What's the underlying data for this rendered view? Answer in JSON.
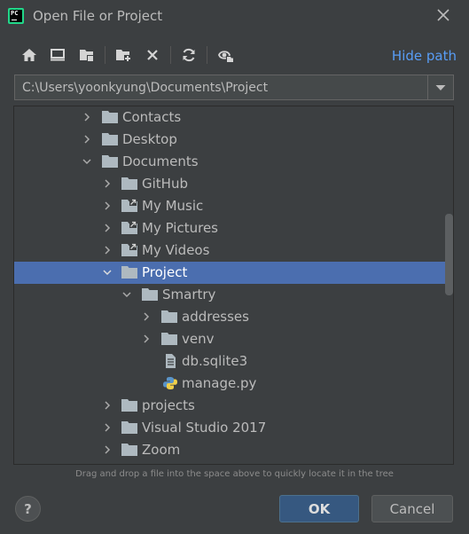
{
  "window": {
    "title": "Open File or Project",
    "logo_text": "PC"
  },
  "toolbar": {
    "hide_path_label": "Hide path",
    "buttons": [
      "home-icon",
      "desktop-icon",
      "project-folder-icon",
      "new-folder-icon",
      "delete-icon",
      "refresh-icon",
      "show-hidden-icon"
    ]
  },
  "path": {
    "value": "C:\\Users\\yoonkyung\\Documents\\Project"
  },
  "tree": {
    "rows": [
      {
        "label": "Contacts",
        "expanded": false
      },
      {
        "label": "Desktop",
        "expanded": false
      },
      {
        "label": "Documents",
        "expanded": true
      },
      {
        "label": "GitHub",
        "expanded": false
      },
      {
        "label": "My Music",
        "expanded": false,
        "symlink": true
      },
      {
        "label": "My Pictures",
        "expanded": false,
        "symlink": true
      },
      {
        "label": "My Videos",
        "expanded": false,
        "symlink": true
      },
      {
        "label": "Project",
        "expanded": true,
        "selected": true
      },
      {
        "label": "Smartry",
        "expanded": true
      },
      {
        "label": "addresses",
        "expanded": false
      },
      {
        "label": "venv",
        "expanded": false
      },
      {
        "label": "db.sqlite3",
        "file": true
      },
      {
        "label": "manage.py",
        "file": true
      },
      {
        "label": "projects",
        "expanded": false
      },
      {
        "label": "Visual Studio 2017",
        "expanded": false
      },
      {
        "label": "Zoom",
        "expanded": false
      }
    ]
  },
  "hint": "Drag and drop a file into the space above to quickly locate it in the tree",
  "buttons": {
    "help": "?",
    "ok": "OK",
    "cancel": "Cancel"
  },
  "colors": {
    "background": "#3c3f41",
    "selection": "#4b6eaf",
    "link": "#589df6",
    "ok_button": "#365880"
  }
}
